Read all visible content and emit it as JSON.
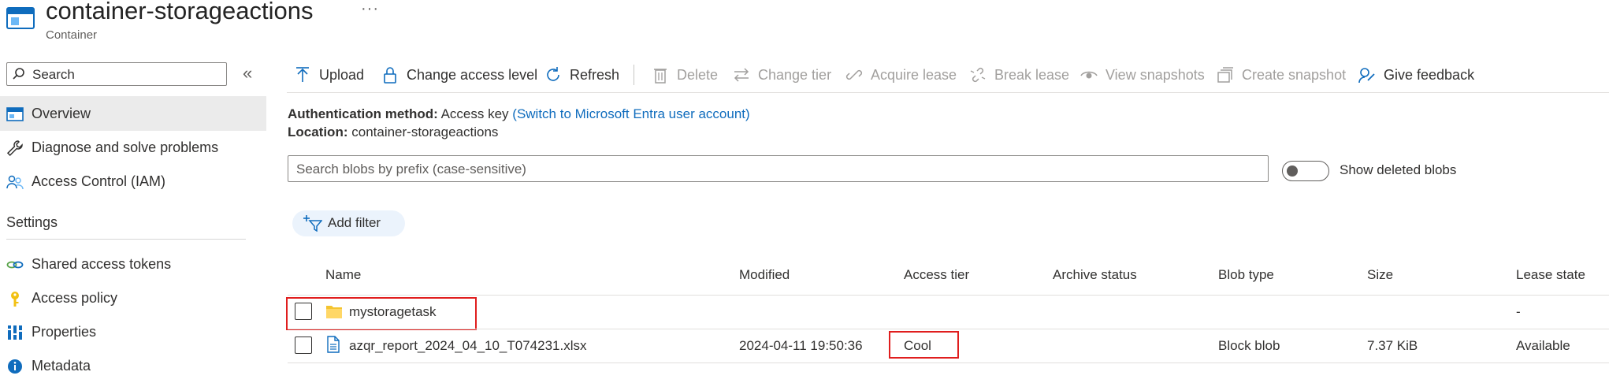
{
  "header": {
    "title": "container-storageactions",
    "subtitle": "Container",
    "more_label": "···"
  },
  "sidebar": {
    "search_placeholder": "Search",
    "collapse_label": "«",
    "items": [
      {
        "label": "Overview",
        "icon": "overview-icon",
        "active": true
      },
      {
        "label": "Diagnose and solve problems",
        "icon": "wrench-icon"
      },
      {
        "label": "Access Control (IAM)",
        "icon": "people-icon"
      }
    ],
    "settings_heading": "Settings",
    "settings_items": [
      {
        "label": "Shared access tokens",
        "icon": "link-icon"
      },
      {
        "label": "Access policy",
        "icon": "key-icon"
      },
      {
        "label": "Properties",
        "icon": "properties-icon"
      },
      {
        "label": "Metadata",
        "icon": "info-icon"
      }
    ]
  },
  "toolbar": {
    "upload": "Upload",
    "change_access": "Change access level",
    "refresh": "Refresh",
    "delete": "Delete",
    "change_tier": "Change tier",
    "acquire_lease": "Acquire lease",
    "break_lease": "Break lease",
    "view_snapshots": "View snapshots",
    "create_snapshot": "Create snapshot",
    "give_feedback": "Give feedback"
  },
  "info": {
    "auth_label": "Authentication method:",
    "auth_value": "Access key",
    "auth_link": "(Switch to Microsoft Entra user account)",
    "location_label": "Location:",
    "location_value": "container-storageactions"
  },
  "blob_search": {
    "placeholder": "Search blobs by prefix (case-sensitive)",
    "toggle_label": "Show deleted blobs",
    "toggle_on": false
  },
  "filter": {
    "label": "Add filter"
  },
  "table": {
    "columns": [
      "Name",
      "Modified",
      "Access tier",
      "Archive status",
      "Blob type",
      "Size",
      "Lease state"
    ],
    "rows": [
      {
        "name": "mystoragetask",
        "type_icon": "folder-icon",
        "modified": "",
        "access_tier": "",
        "archive_status": "",
        "blob_type": "",
        "size": "",
        "lease_state": "-"
      },
      {
        "name": "azqr_report_2024_04_10_T074231.xlsx",
        "type_icon": "file-icon",
        "modified": "2024-04-11 19:50:36",
        "access_tier": "Cool",
        "archive_status": "",
        "blob_type": "Block blob",
        "size": "7.37 KiB",
        "lease_state": "Available"
      }
    ]
  },
  "colors": {
    "accent": "#0f6cbd",
    "highlight": "#e01e1e",
    "folder": "#f4c430"
  }
}
